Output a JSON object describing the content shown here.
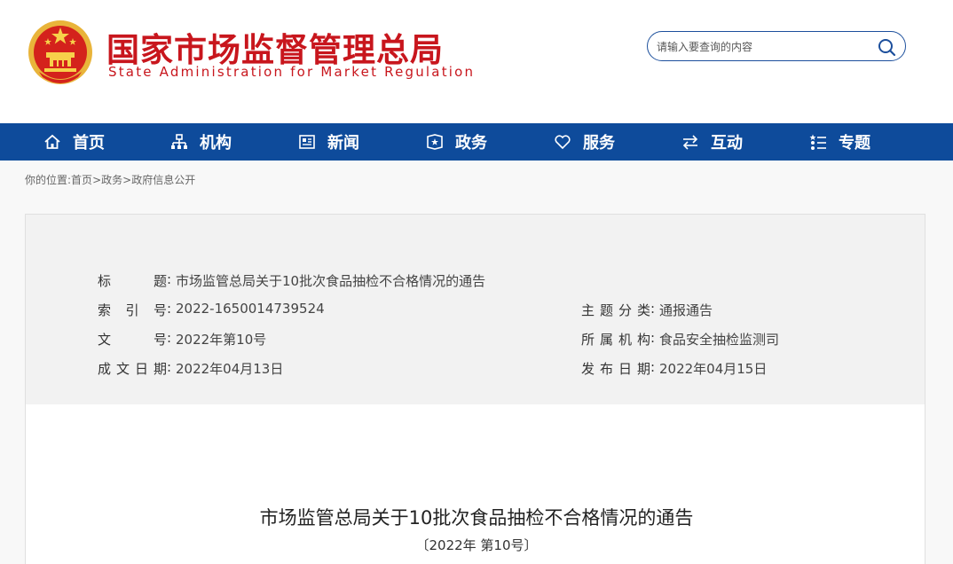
{
  "header": {
    "site_name": "国家市场监督管理总局",
    "site_name_en": "State Administration for Market Regulation",
    "emblem_icon": "national-emblem-icon",
    "brand_color": "#c8161d"
  },
  "search": {
    "placeholder": "请输入要查询的内容",
    "icon": "search-icon"
  },
  "nav": {
    "bg_color": "#0e4b9b",
    "items": [
      {
        "label": "首页",
        "icon": "home-icon"
      },
      {
        "label": "机构",
        "icon": "org-chart-icon"
      },
      {
        "label": "新闻",
        "icon": "newspaper-icon"
      },
      {
        "label": "政务",
        "icon": "shield-book-icon"
      },
      {
        "label": "服务",
        "icon": "heart-icon"
      },
      {
        "label": "互动",
        "icon": "exchange-arrows-icon"
      },
      {
        "label": "专题",
        "icon": "list-icon"
      }
    ]
  },
  "breadcrumb": {
    "prefix": "你的位置:",
    "items": [
      "首页",
      "政务",
      "政府信息公开"
    ],
    "separator": ">"
  },
  "info": {
    "title_key": "标　　题",
    "title_value": "市场监管总局关于10批次食品抽检不合格情况的通告",
    "index_key": "索 引 号",
    "index_value": "2022-1650014739524",
    "doc_no_key": "文　　号",
    "doc_no_value": "2022年第10号",
    "created_key": "成文日期",
    "created_value": "2022年04月13日",
    "category_key": "主题分类",
    "category_value": "通报通告",
    "org_key": "所属机构",
    "org_value": "食品安全抽检监测司",
    "published_key": "发布日期",
    "published_value": "2022年04月15日"
  },
  "document": {
    "title": "市场监管总局关于10批次食品抽检不合格情况的通告",
    "subtitle": "〔2022年 第10号〕"
  }
}
